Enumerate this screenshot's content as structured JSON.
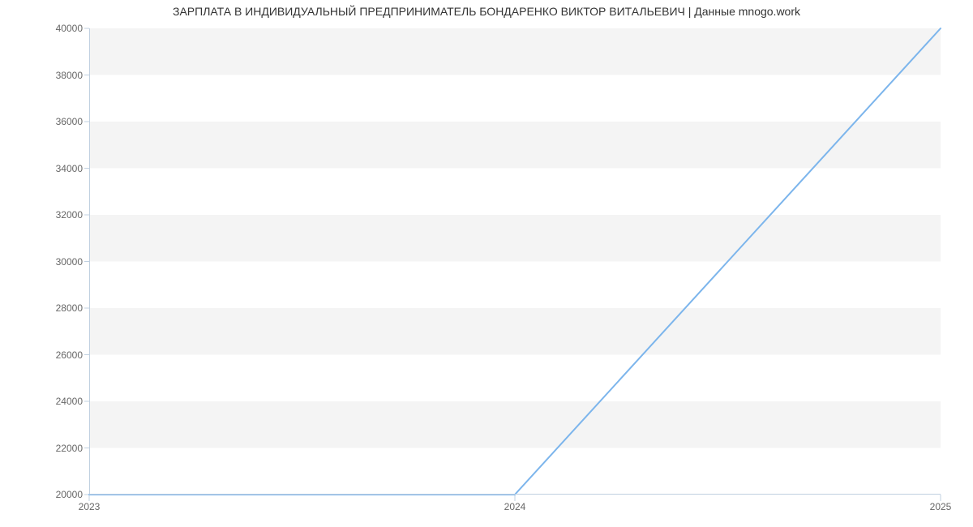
{
  "chart_data": {
    "type": "line",
    "x": [
      2023,
      2024,
      2025
    ],
    "values": [
      20000,
      20000,
      40000
    ],
    "title": "ЗАРПЛАТА В ИНДИВИДУАЛЬНЫЙ ПРЕДПРИНИМАТЕЛЬ БОНДАРЕНКО ВИКТОР ВИТАЛЬЕВИЧ | Данные mnogo.work",
    "xlabel": "",
    "ylabel": "",
    "xlim": [
      2023,
      2025
    ],
    "ylim": [
      20000,
      40000
    ],
    "x_ticks": [
      2023,
      2024,
      2025
    ],
    "y_ticks": [
      20000,
      22000,
      24000,
      26000,
      28000,
      30000,
      32000,
      34000,
      36000,
      38000,
      40000
    ],
    "colors": {
      "line": "#7cb5ec",
      "grid_band": "#f4f4f4",
      "axis": "#c0d0e0",
      "tick_text": "#666666",
      "title_text": "#333333"
    }
  }
}
